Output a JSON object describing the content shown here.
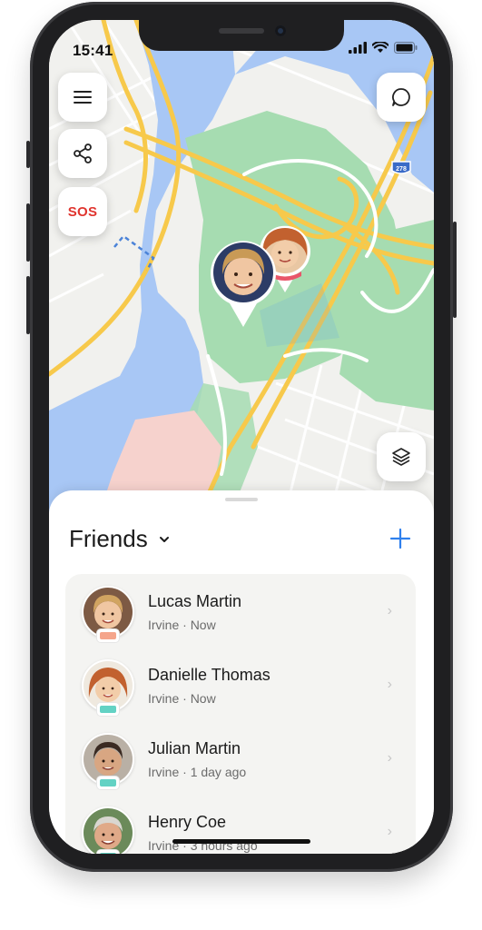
{
  "status_bar": {
    "time": "15:41"
  },
  "map": {
    "road_shield": "278",
    "controls": [
      {
        "name": "menu-icon"
      },
      {
        "name": "share-icon"
      },
      {
        "name": "sos",
        "label": "SOS"
      },
      {
        "name": "chat-icon"
      },
      {
        "name": "layers-icon"
      }
    ],
    "colors": {
      "water": "#a8c7f5",
      "park": "#a6dcb1",
      "road": "#f7c94b",
      "land": "#f1f1ee"
    }
  },
  "sheet": {
    "title": "Friends",
    "friends": [
      {
        "name": "Lucas Martin",
        "location": "Irvine",
        "time": "Now",
        "battery_color": "#f5a58b",
        "avatar": "boy-blond"
      },
      {
        "name": "Danielle Thomas",
        "location": "Irvine",
        "time": "Now",
        "battery_color": "#63d2c4",
        "avatar": "girl-redhead"
      },
      {
        "name": "Julian Martin",
        "location": "Irvine",
        "time": "1 day ago",
        "battery_color": "#63d2c4",
        "avatar": "boy-dark"
      },
      {
        "name": "Henry Coe",
        "location": "Irvine",
        "time": "3 hours ago",
        "battery_color": "#63d2c4",
        "avatar": "man-grey"
      }
    ],
    "separator": "·"
  }
}
